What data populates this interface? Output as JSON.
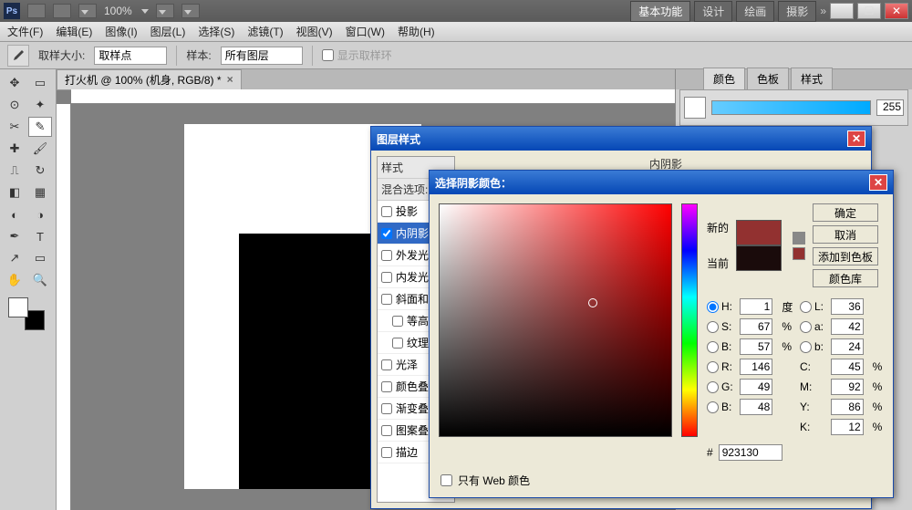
{
  "titlebar": {
    "zoom": "100%"
  },
  "workspace_buttons": {
    "basic": "基本功能",
    "design": "设计",
    "paint": "绘画",
    "photo": "摄影"
  },
  "menu": {
    "file": "文件(F)",
    "edit": "编辑(E)",
    "image": "图像(I)",
    "layer": "图层(L)",
    "select": "选择(S)",
    "filter": "滤镜(T)",
    "view": "视图(V)",
    "window": "窗口(W)",
    "help": "帮助(H)"
  },
  "options": {
    "sample_size": "取样大小:",
    "sample_point": "取样点",
    "sample": "样本:",
    "all_layers": "所有图层",
    "show_ring": "显示取样环"
  },
  "doc_tab": "打火机 @ 100% (机身, RGB/8) *",
  "panels": {
    "color": "颜色",
    "swatches": "色板",
    "styles": "样式",
    "value": "255"
  },
  "layer_style": {
    "title": "图层样式",
    "styles_hdr": "样式",
    "blend_hdr": "混合选项:默",
    "items": [
      {
        "label": "投影",
        "on": false
      },
      {
        "label": "内阴影",
        "on": true,
        "sel": true
      },
      {
        "label": "外发光",
        "on": false
      },
      {
        "label": "内发光",
        "on": false
      },
      {
        "label": "斜面和浮",
        "on": false
      },
      {
        "label": "等高线",
        "on": false,
        "indent": true
      },
      {
        "label": "纹理",
        "on": false,
        "indent": true
      },
      {
        "label": "光泽",
        "on": false
      },
      {
        "label": "颜色叠加",
        "on": false
      },
      {
        "label": "渐变叠加",
        "on": false
      },
      {
        "label": "图案叠加",
        "on": false
      },
      {
        "label": "描边",
        "on": false
      }
    ],
    "inner_shadow": "内阴影"
  },
  "color_picker": {
    "title": "选择阴影颜色：",
    "new": "新的",
    "current": "当前",
    "ok": "确定",
    "cancel": "取消",
    "add": "添加到色板",
    "lib": "颜色库",
    "H": "1",
    "S": "67",
    "B": "57",
    "R": "146",
    "G": "49",
    "Bb": "48",
    "L": "36",
    "a": "42",
    "bb": "24",
    "C": "45",
    "M": "92",
    "Y": "86",
    "K": "12",
    "deg": "度",
    "pct": "%",
    "hash": "#",
    "hex": "923130",
    "web_only": "只有 Web 颜色",
    "H_l": "H:",
    "S_l": "S:",
    "B_l": "B:",
    "R_l": "R:",
    "G_l": "G:",
    "Bb_l": "B:",
    "L_l": "L:",
    "a_l": "a:",
    "bb_l": "b:",
    "C_l": "C:",
    "M_l": "M:",
    "Y_l": "Y:",
    "K_l": "K:"
  }
}
